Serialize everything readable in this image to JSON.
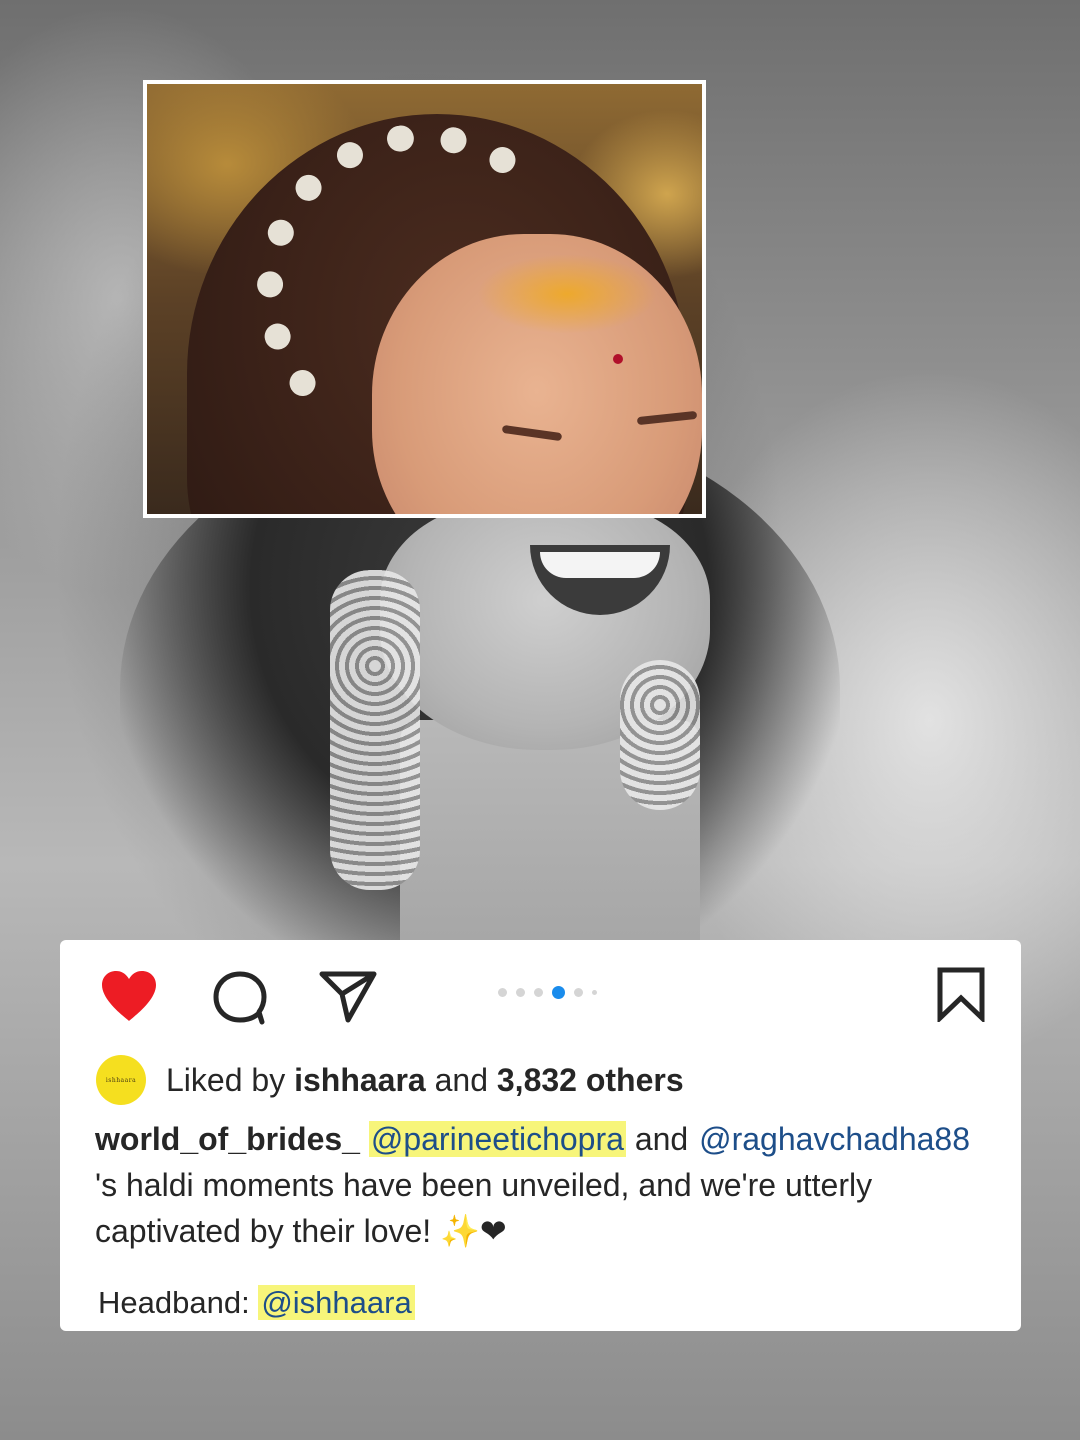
{
  "post": {
    "likes": {
      "prefix": "Liked by ",
      "user": "ishhaara",
      "middle": " and ",
      "count": "3,832 others",
      "avatar_text": "ishhaara"
    },
    "caption": {
      "username": "world_of_brides_",
      "mention1": "@parineetichopra",
      "connector": " and ",
      "mention2": "@raghavchadha88",
      "body": "'s haldi moments have been unveiled, and we're utterly captivated by their love! ",
      "emoji": "✨❤"
    },
    "credit": {
      "label": "Headband: ",
      "mention": "@ishhaara"
    }
  },
  "carousel": {
    "total": 6,
    "active_index": 3
  },
  "icons": [
    "heart-icon",
    "comment-icon",
    "share-icon",
    "bookmark-icon"
  ],
  "colors": {
    "heart": "#ed1c24",
    "active_dot": "#1a8cec",
    "highlight": "#f7f57a",
    "mention_text": "#1d4e89",
    "avatar_bg": "#f5df1f"
  }
}
